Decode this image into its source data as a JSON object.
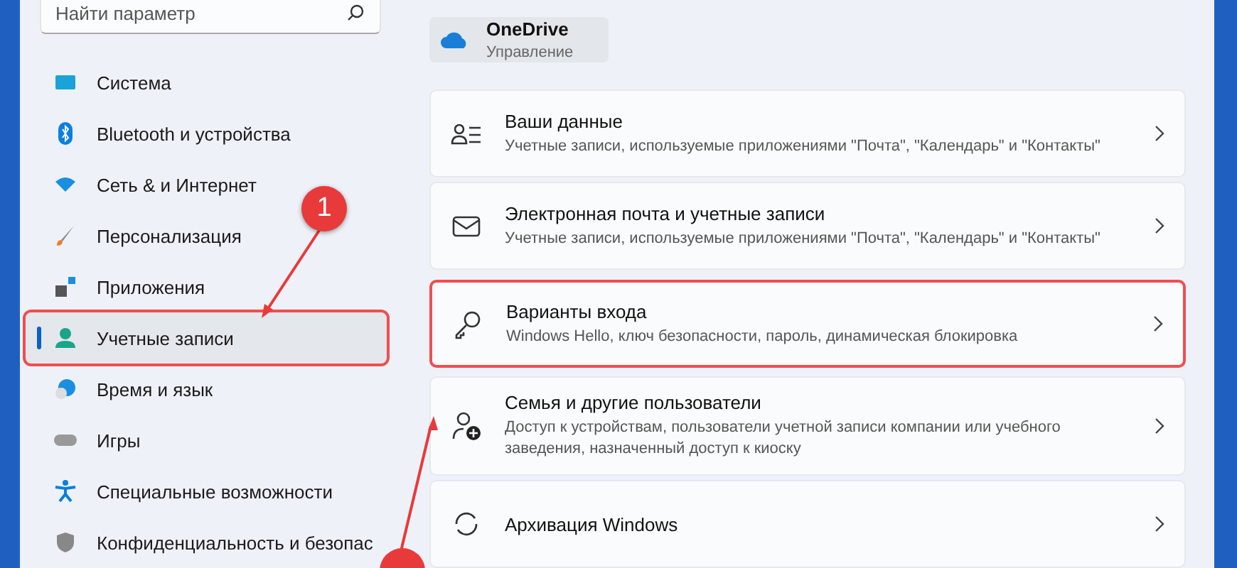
{
  "search": {
    "placeholder": "Найти параметр"
  },
  "nav": [
    {
      "label": "Система",
      "selected": false,
      "highlighted": false
    },
    {
      "label": "Bluetooth и устройства",
      "selected": false,
      "highlighted": false
    },
    {
      "label": "Сеть & и Интернет",
      "selected": false,
      "highlighted": false
    },
    {
      "label": "Персонализация",
      "selected": false,
      "highlighted": false
    },
    {
      "label": "Приложения",
      "selected": false,
      "highlighted": false
    },
    {
      "label": "Учетные записи",
      "selected": true,
      "highlighted": true
    },
    {
      "label": "Время и язык",
      "selected": false,
      "highlighted": false
    },
    {
      "label": "Игры",
      "selected": false,
      "highlighted": false
    },
    {
      "label": "Специальные возможности",
      "selected": false,
      "highlighted": false
    },
    {
      "label": "Конфиденциальность и безопас",
      "selected": false,
      "highlighted": false
    }
  ],
  "onedrive": {
    "title": "OneDrive",
    "subtitle": "Управление"
  },
  "cards": [
    {
      "title": "Ваши данные",
      "subtitle": "Учетные записи, используемые приложениями \"Почта\", \"Календарь\" и \"Контакты\"",
      "highlighted": false
    },
    {
      "title": "Электронная почта и учетные записи",
      "subtitle": "Учетные записи, используемые приложениями \"Почта\", \"Календарь\" и \"Контакты\"",
      "highlighted": false
    },
    {
      "title": "Варианты входа",
      "subtitle": "Windows Hello, ключ безопасности, пароль, динамическая блокировка",
      "highlighted": true
    },
    {
      "title": "Семья и другие пользователи",
      "subtitle": "Доступ к устройствам, пользователи учетной записи компании или учебного заведения, назначенный доступ к киоску",
      "highlighted": false
    },
    {
      "title": "Архивация Windows",
      "highlighted": false
    }
  ],
  "annotations": [
    {
      "label": "1"
    }
  ]
}
